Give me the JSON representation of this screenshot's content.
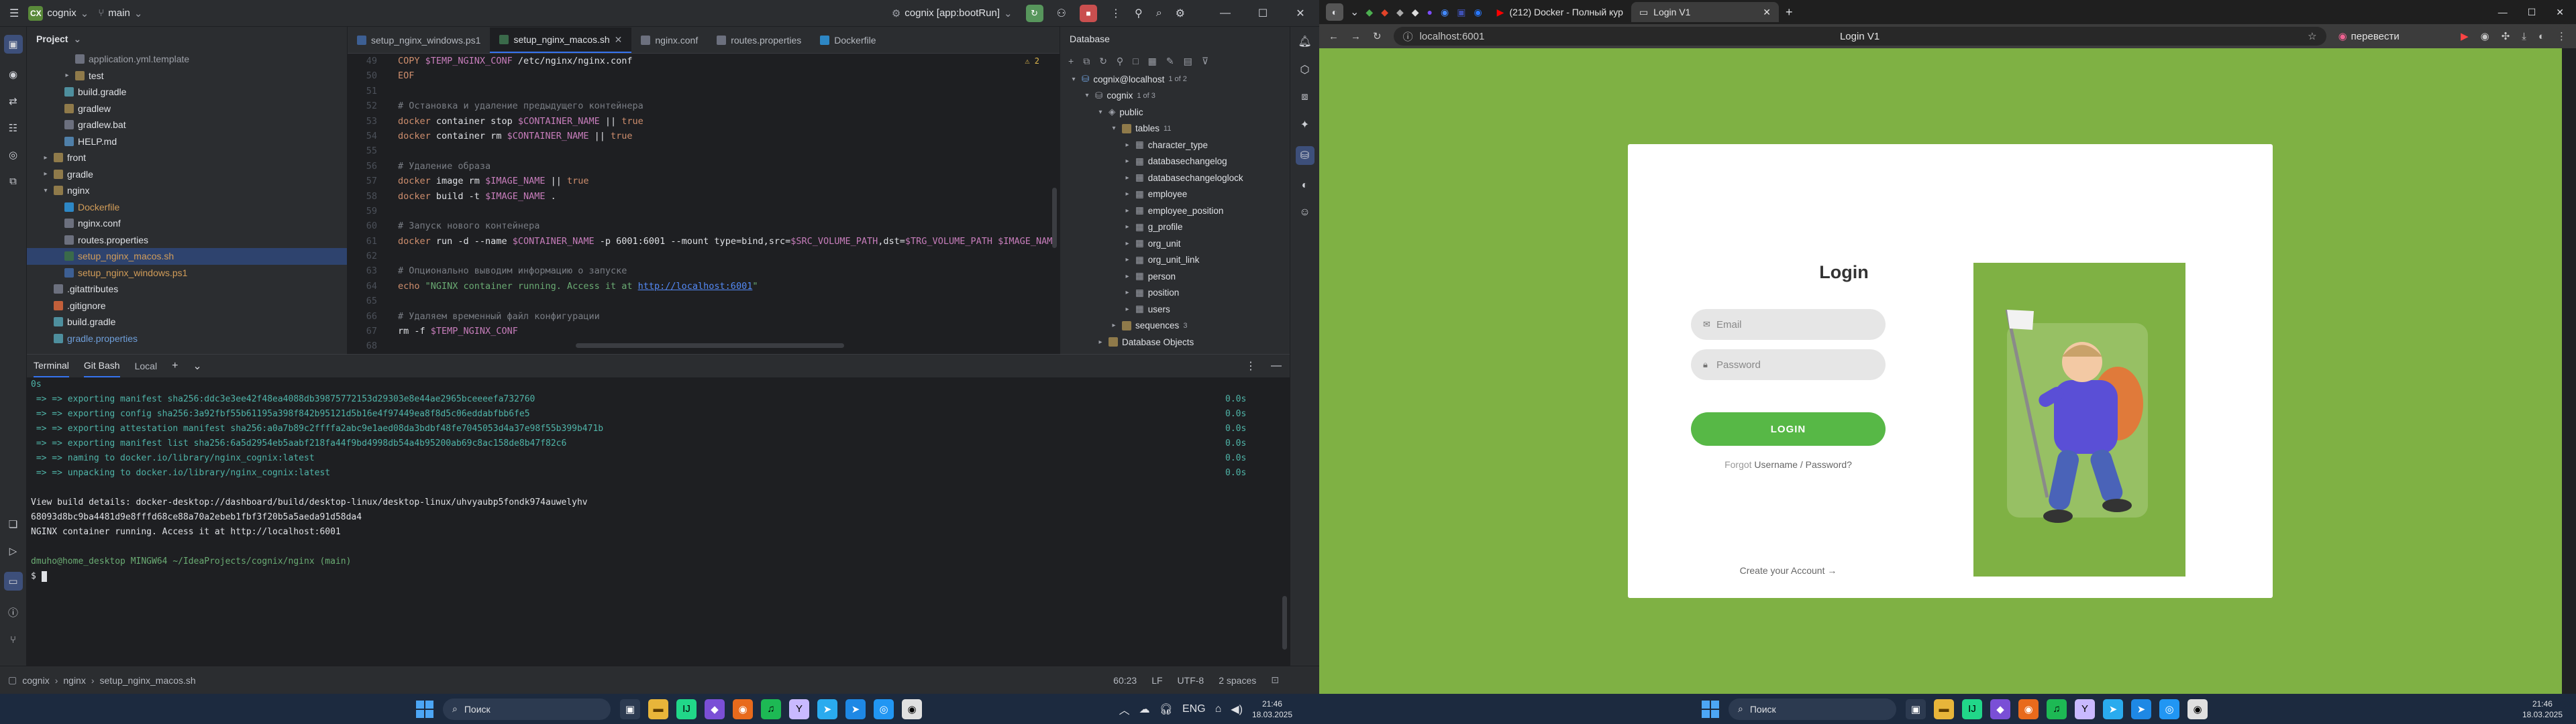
{
  "ide": {
    "titlebar": {
      "project_badge": "CX",
      "project_name": "cognix",
      "branch": "main",
      "run_config": "cognix [app:bootRun]"
    },
    "project_panel": {
      "title": "Project",
      "rows": [
        {
          "indent": 3,
          "type": "file",
          "label": "application.yml.template",
          "color": "c-gray"
        },
        {
          "indent": 3,
          "type": "folder",
          "label": "test",
          "arrow": "▸",
          "color": ""
        },
        {
          "indent": 2,
          "type": "gradle",
          "label": "build.gradle",
          "color": ""
        },
        {
          "indent": 2,
          "type": "folder",
          "label": "gradlew",
          "color": ""
        },
        {
          "indent": 2,
          "type": "file",
          "label": "gradlew.bat",
          "color": ""
        },
        {
          "indent": 2,
          "type": "md",
          "label": "HELP.md",
          "color": ""
        },
        {
          "indent": 1,
          "type": "folder",
          "label": "front",
          "arrow": "▸",
          "color": ""
        },
        {
          "indent": 1,
          "type": "folder",
          "label": "gradle",
          "arrow": "▸",
          "color": ""
        },
        {
          "indent": 1,
          "type": "folder",
          "label": "nginx",
          "arrow": "▾",
          "color": ""
        },
        {
          "indent": 2,
          "type": "docker",
          "label": "Dockerfile",
          "color": "c-orange"
        },
        {
          "indent": 2,
          "type": "file",
          "label": "nginx.conf",
          "color": ""
        },
        {
          "indent": 2,
          "type": "file",
          "label": "routes.properties",
          "color": ""
        },
        {
          "indent": 2,
          "type": "sh",
          "label": "setup_nginx_macos.sh",
          "color": "c-orange",
          "selected": true
        },
        {
          "indent": 2,
          "type": "ps",
          "label": "setup_nginx_windows.ps1",
          "color": "c-orange"
        },
        {
          "indent": 1,
          "type": "file",
          "label": ".gitattributes",
          "color": ""
        },
        {
          "indent": 1,
          "type": "git",
          "label": ".gitignore",
          "color": ""
        },
        {
          "indent": 1,
          "type": "gradle",
          "label": "build.gradle",
          "color": ""
        },
        {
          "indent": 1,
          "type": "gradle",
          "label": "gradle.properties",
          "color": "c-blue"
        }
      ]
    },
    "editor": {
      "tabs": [
        {
          "label": "setup_nginx_windows.ps1",
          "icon": "ps",
          "active": false
        },
        {
          "label": "setup_nginx_macos.sh",
          "icon": "sh",
          "active": true
        },
        {
          "label": "nginx.conf",
          "icon": "file",
          "active": false
        },
        {
          "label": "routes.properties",
          "icon": "file",
          "active": false
        },
        {
          "label": "Dockerfile",
          "icon": "docker",
          "active": false
        }
      ],
      "problems": "2",
      "lines": [
        {
          "n": "49",
          "html": "<span class=\"kw\">COPY</span> <span class=\"var\">$TEMP_NGINX_CONF</span> /etc/nginx/nginx.conf"
        },
        {
          "n": "50",
          "html": "<span class=\"kw\">EOF</span>"
        },
        {
          "n": "51",
          "html": ""
        },
        {
          "n": "52",
          "html": "<span class=\"cm\"># Остановка и удаление предыдущего контейнера</span>"
        },
        {
          "n": "53",
          "html": "<span class=\"kw\">docker</span> container stop <span class=\"var\">$CONTAINER_NAME</span> || <span class=\"kw\">true</span>"
        },
        {
          "n": "54",
          "html": "<span class=\"kw\">docker</span> container rm <span class=\"var\">$CONTAINER_NAME</span> || <span class=\"kw\">true</span>"
        },
        {
          "n": "55",
          "html": ""
        },
        {
          "n": "56",
          "html": "<span class=\"cm\"># Удаление образа</span>"
        },
        {
          "n": "57",
          "html": "<span class=\"kw\">docker</span> image rm <span class=\"var\">$IMAGE_NAME</span> || <span class=\"kw\">true</span>"
        },
        {
          "n": "58",
          "html": "<span class=\"kw\">docker</span> build -t <span class=\"var\">$IMAGE_NAME</span> ."
        },
        {
          "n": "59",
          "html": ""
        },
        {
          "n": "60",
          "html": "<span class=\"cm\"># Запуск нового контейнера</span>"
        },
        {
          "n": "61",
          "html": "<span class=\"kw\">docker</span> run -d --name <span class=\"var\">$CONTAINER_NAME</span> -p 6001:6001 --mount type=bind,src=<span class=\"var\">$SRC_VOLUME_PATH</span>,dst=<span class=\"var\">$TRG_VOLUME_PATH</span> <span class=\"var\">$IMAGE_NAME</span>"
        },
        {
          "n": "62",
          "html": ""
        },
        {
          "n": "63",
          "html": "<span class=\"cm\"># Опционально выводим информацию о запуске</span>"
        },
        {
          "n": "64",
          "html": "<span class=\"kw\">echo</span> <span class=\"str\">\"NGINX container running. Access it at <span class=\"lnk\">http://localhost:6001</span>\"</span>"
        },
        {
          "n": "65",
          "html": ""
        },
        {
          "n": "66",
          "html": "<span class=\"cm\"># Удаляем временный файл конфигурации</span>"
        },
        {
          "n": "67",
          "html": "rm -f <span class=\"var\">$TEMP_NGINX_CONF</span>"
        },
        {
          "n": "68",
          "html": ""
        }
      ]
    },
    "database": {
      "title": "Database",
      "tables": [
        "character_type",
        "databasechangelog",
        "databasechangeloglock",
        "employee",
        "employee_position",
        "g_profile",
        "org_unit",
        "org_unit_link",
        "person",
        "position",
        "users"
      ],
      "connection": "cognix@localhost",
      "connection_count": "1 of 2",
      "db_name": "cognix",
      "db_count": "1 of 3",
      "schema": "public",
      "tables_label": "tables",
      "tables_count": "11",
      "sequences": "sequences",
      "sequences_count": "3",
      "db_objects": "Database Objects"
    },
    "terminal": {
      "tabs": [
        "Terminal",
        "Git Bash",
        "Local"
      ],
      "lines": [
        {
          "cls": "t-teal",
          "text": "0s",
          "time": ""
        },
        {
          "cls": "t-teal",
          "text": " => => exporting manifest sha256:ddc3e3ee42f48ea4088db39875772153d29303e8e44ae2965bceeeefa732760",
          "time": "0.0s"
        },
        {
          "cls": "t-teal",
          "text": " => => exporting config sha256:3a92fbf55b61195a398f842b95121d5b16e4f97449ea8f8d5c06eddabfbb6fe5",
          "time": "0.0s"
        },
        {
          "cls": "t-teal",
          "text": " => => exporting attestation manifest sha256:a0a7b89c2ffffa2abc9e1aed08da3bdbf48fe7045053d4a37e98f55b399b471b",
          "time": "0.0s"
        },
        {
          "cls": "t-teal",
          "text": " => => exporting manifest list sha256:6a5d2954eb5aabf218fa44f9bd4998db54a4b95200ab69c8ac158de8b47f82c6",
          "time": "0.0s"
        },
        {
          "cls": "t-teal",
          "text": " => => naming to docker.io/library/nginx_cognix:latest",
          "time": "0.0s"
        },
        {
          "cls": "t-teal",
          "text": " => => unpacking to docker.io/library/nginx_cognix:latest",
          "time": "0.0s"
        },
        {
          "cls": "",
          "text": "",
          "time": ""
        },
        {
          "cls": "",
          "text": "View build details: docker-desktop://dashboard/build/desktop-linux/desktop-linux/uhvyaubp5fondk974auwelyhv",
          "time": ""
        },
        {
          "cls": "",
          "text": "68093d8bc9ba4481d9e8fffd68ce88a70a2ebeb1fbf3f20b5a5aeda91d58da4",
          "time": ""
        },
        {
          "cls": "",
          "text": "NGINX container running. Access it at http://localhost:6001",
          "time": ""
        },
        {
          "cls": "",
          "text": "",
          "time": ""
        },
        {
          "cls": "prompt",
          "text": "dmuho@home_desktop MINGW64 ~/IdeaProjects/cognix/nginx (main)",
          "time": ""
        },
        {
          "cls": "",
          "text": "$ ",
          "time": ""
        }
      ]
    },
    "statusbar": {
      "crumbs": [
        "cognix",
        "nginx",
        "setup_nginx_macos.sh"
      ],
      "position": "60:23",
      "line_sep": "LF",
      "encoding": "UTF-8",
      "indent": "2 spaces"
    }
  },
  "browser": {
    "tabs": [
      {
        "label": "(212) Docker - Полный кур",
        "active": false
      },
      {
        "label": "Login V1",
        "active": true
      }
    ],
    "url": "localhost:6001",
    "page_title": "Login V1",
    "translate": "перевести",
    "login": {
      "title": "Login",
      "email_placeholder": "Email",
      "password_placeholder": "Password",
      "button": "LOGIN",
      "forgot_prefix": "Forgot",
      "forgot_link": "Username / Password?",
      "create": "Create your Account"
    }
  },
  "taskbar": {
    "search": "Поиск",
    "lang": "ENG",
    "time": "21:46",
    "date": "18.03.2025"
  }
}
